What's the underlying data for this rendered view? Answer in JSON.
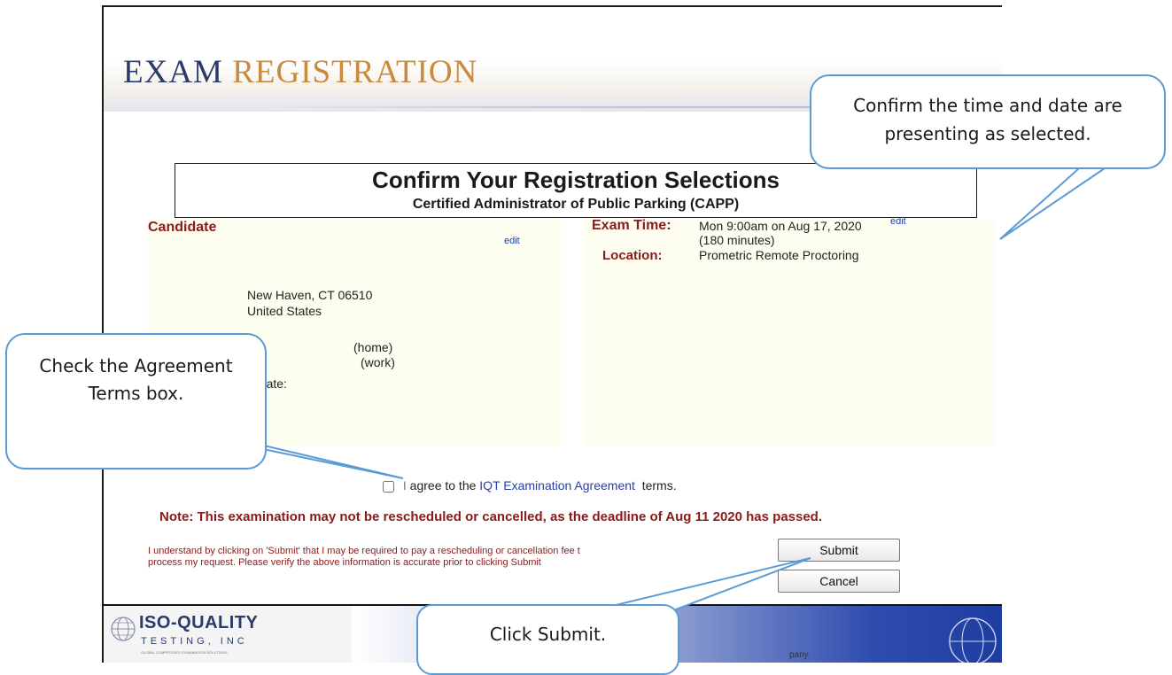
{
  "header": {
    "title_word1": "EXAM",
    "title_word2": "REGISTRATION"
  },
  "confirm": {
    "title": "Confirm Your Registration Selections",
    "subtitle": "Certified Administrator of Public Parking (CAPP)"
  },
  "candidate": {
    "label": "Candidate",
    "edit": "edit",
    "city_line": "New Haven, CT 06510",
    "country": "United States",
    "home_suffix": "(home)",
    "work_suffix": "(work)",
    "birthdate_label_partial": "hdate:"
  },
  "exam": {
    "time_label": "Exam Time:",
    "time_value": "Mon 9:00am on Aug 17, 2020",
    "time_edit": "edit",
    "duration": "(180 minutes)",
    "location_label": "Location:",
    "location_value": "Prometric Remote Proctoring"
  },
  "agreement": {
    "prefix": "agree to the",
    "link": "IQT Examination Agreement",
    "suffix": "terms.",
    "checked": false
  },
  "note": "Note: This examination may not be rescheduled or cancelled, as the deadline of Aug 11 2020 has passed.",
  "disclaimer_line1": "I understand by clicking on 'Submit' that I may be required to pay a rescheduling or cancellation fee t",
  "disclaimer_line2": "process my request. Please verify the above information is accurate prior to clicking Submit",
  "buttons": {
    "submit": "Submit",
    "cancel": "Cancel"
  },
  "footer": {
    "brand": "ISO-QUALITY",
    "brand_sub": "TESTING, INC",
    "tagline": "GLOBAL COMPETENCY EXAMINATION SOLUTIONS",
    "partial_text": "pany"
  },
  "callouts": {
    "time_date": "Confirm the time and date are presenting as selected.",
    "agreement": "Check the Agreement Terms box.",
    "submit": "Click Submit."
  },
  "colors": {
    "callout_border": "#5b9bd5",
    "note_red": "#8b1a1a",
    "title_navy": "#2b3a6b",
    "title_gold": "#c98a3b"
  }
}
